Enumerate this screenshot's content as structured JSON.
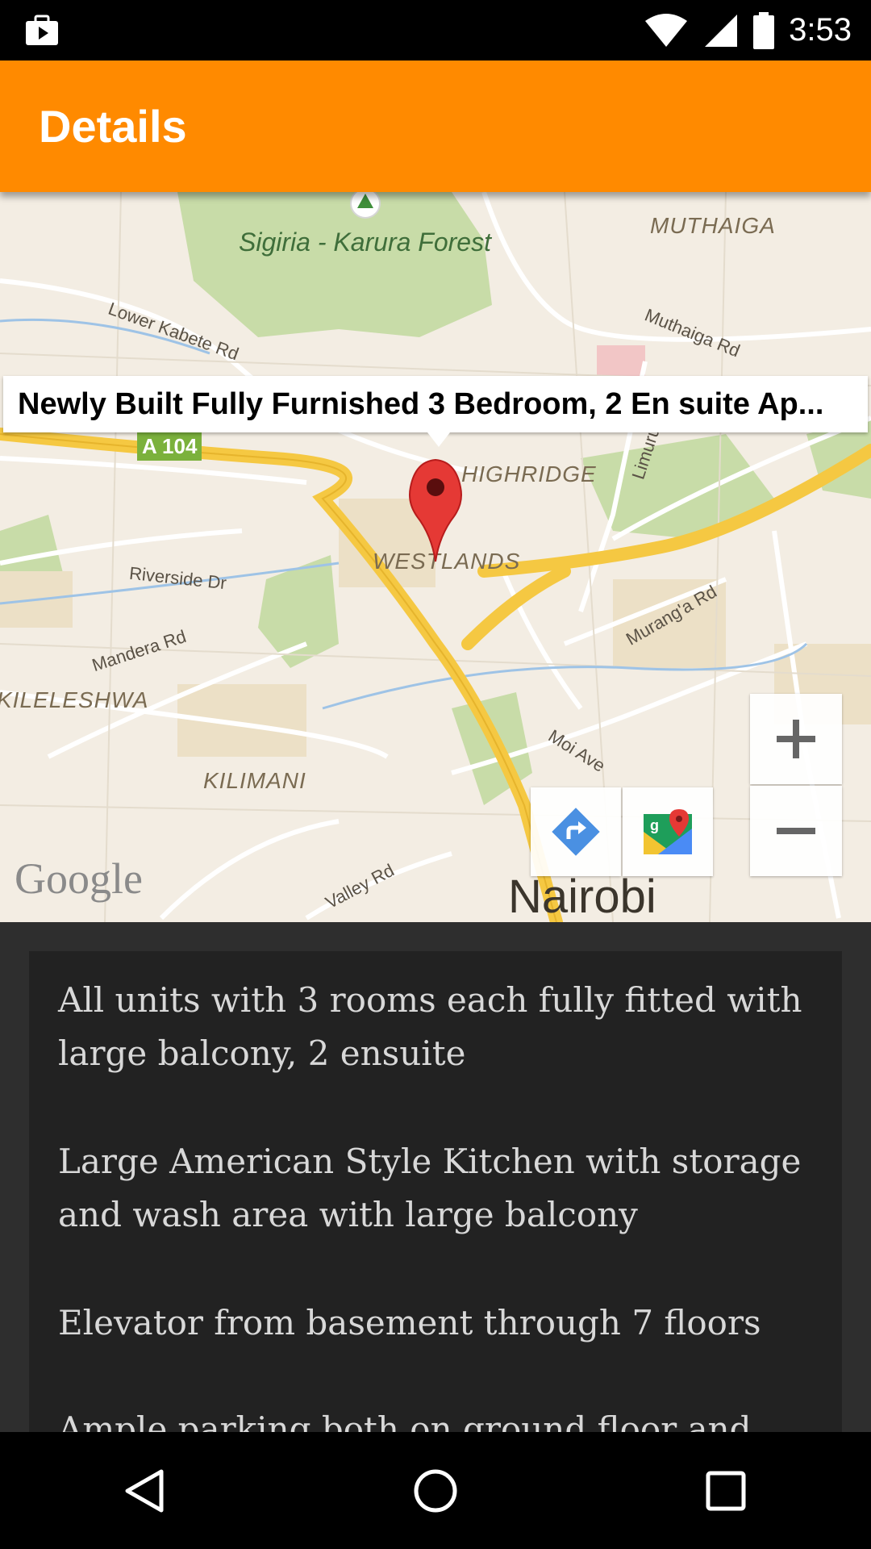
{
  "status_bar": {
    "time": "3:53",
    "left_icon": "briefcase-play-icon",
    "wifi_icon": "wifi-icon",
    "signal_icon": "cell-signal-icon",
    "battery_icon": "battery-icon"
  },
  "toolbar": {
    "title": "Details",
    "color": "#ff8a00"
  },
  "map": {
    "info_window_title": "Newly Built Fully Furnished 3 Bedroom, 2 En suite Ap...",
    "labels": {
      "forest": "Sigiria - Karura Forest",
      "muthaiga": "MUTHAIGA",
      "muthaiga_rd": "Muthaiga Rd",
      "lower_kabete_rd": "Lower Kabete Rd",
      "a104": "A 104",
      "highridge": "HIGHRIDGE",
      "limuru_rd": "Limuru R",
      "westlands": "WESTLANDS",
      "riverside_dr": "Riverside Dr",
      "mandera_rd": "Mandera Rd",
      "murangа_rd": "Murang'a Rd",
      "kileleshwa": "KILELESHWA",
      "moi_ave": "Moi Ave",
      "kilimani": "KILIMANI",
      "valley_rd": "Valley Rd",
      "nairobi": "Nairobi",
      "google": "Google"
    },
    "controls": {
      "zoom_in_icon": "plus-icon",
      "zoom_out_icon": "minus-icon",
      "directions_icon": "directions-icon",
      "open_maps_icon": "google-maps-icon"
    }
  },
  "details": {
    "paragraphs": [
      "All units with 3 rooms each fully fitted with large balcony, 2 ensuite",
      "Large American Style Kitchen with storage and wash area with large balcony",
      "Elevator from basement through 7 floors",
      "Ample parking both on ground floor and"
    ]
  },
  "nav_bar": {
    "back_icon": "back-triangle-icon",
    "home_icon": "home-circle-icon",
    "recents_icon": "recents-square-icon"
  }
}
